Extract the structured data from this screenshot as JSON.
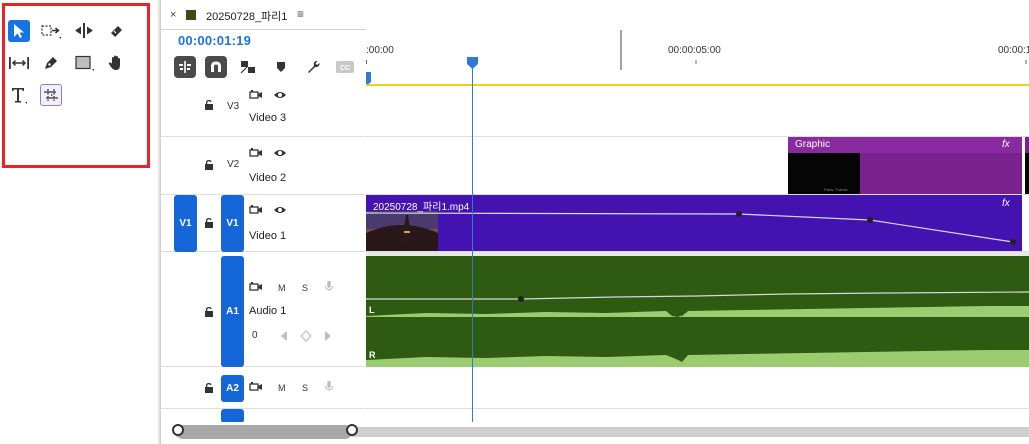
{
  "tab": {
    "close": "×",
    "title": "20250728_파리1",
    "menu": "≡",
    "swatch_color": "#3d4a12"
  },
  "timecode": "00:00:01:19",
  "ruler": {
    "labels": [
      ":00:00",
      "00:00:05:00",
      "00:00:1"
    ]
  },
  "tracks": {
    "v3": {
      "id": "V3",
      "name": "Video 3"
    },
    "v2": {
      "id": "V2",
      "name": "Video 2"
    },
    "v1": {
      "id": "V1",
      "name": "Video 1",
      "source_patch": "V1",
      "target": "V1"
    },
    "a1": {
      "id": "A1",
      "name": "Audio 1",
      "target": "A1",
      "mute": "M",
      "solo": "S",
      "volume_knob": "0"
    },
    "a2": {
      "id": "A2",
      "target": "A2",
      "mute": "M",
      "solo": "S"
    }
  },
  "clips": {
    "graphic": {
      "label": "Graphic",
      "fx": "fx",
      "thumb_text": "Paris, France"
    },
    "video": {
      "label": "20250728_파리1.mp4",
      "fx": "fx"
    },
    "audio": {
      "channel_left": "L",
      "channel_right": "R"
    }
  },
  "tools": [
    "selection-tool",
    "track-select-forward-tool",
    "ripple-edit-tool",
    "razor-tool",
    "slip-tool",
    "pen-tool",
    "rectangle-tool",
    "hand-tool",
    "type-tool",
    "remix-tool"
  ],
  "colors": {
    "accent": "#1473e6",
    "highlight_frame": "#e8242a",
    "graphic_clip": "#7a2190",
    "video_clip": "#4412b0",
    "audio_clip": "#2f5a12",
    "audio_wave": "#9ccc70",
    "playhead": "#2e7bd6",
    "work_area": "#e6d51a"
  }
}
